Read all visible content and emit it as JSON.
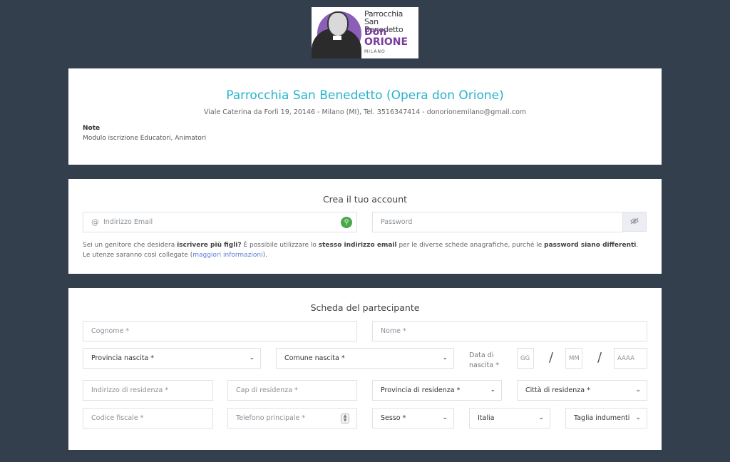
{
  "logo": {
    "line1": "Parrocchia",
    "line2": "San Benedetto",
    "line3": "Don",
    "line4": "ORIONE",
    "line5": "MILANO"
  },
  "header": {
    "title": "Parrocchia San Benedetto (Opera don Orione)",
    "address": "Viale Caterina da Forlì 19, 20146 - Milano (MI), Tel. 3516347414 - donorionemilano@gmail.com",
    "note_label": "Note",
    "note_text": "Modulo iscrizione Educatori, Animatori"
  },
  "account": {
    "title": "Crea il tuo account",
    "email_placeholder": "Indirizzo Email",
    "password_placeholder": "Password",
    "info": {
      "p1": "Sei un genitore che desidera ",
      "b1": "iscrivere più figli?",
      "p2": " È possibile utilizzare lo ",
      "b2": "stesso indirizzo email",
      "p3": " per le diverse schede anagrafiche, purché le ",
      "b3": "password siano differenti",
      "p4": ". Le utenze saranno così collegate (",
      "link": "maggiori informazioni",
      "p5": ")."
    }
  },
  "participant": {
    "title": "Scheda del partecipante",
    "cognome": "Cognome *",
    "nome": "Nome *",
    "provincia_nascita": "Provincia nascita *",
    "comune_nascita": "Comune nascita *",
    "data_nascita_label_1": "Data di",
    "data_nascita_label_2": "nascita *",
    "gg": "GG",
    "mm": "MM",
    "aaaa": "AAAA",
    "slash": "/",
    "indirizzo_residenza": "Indirizzo di residenza *",
    "cap_residenza": "Cap di residenza *",
    "provincia_residenza": "Provincia di residenza *",
    "citta_residenza": "Città di residenza *",
    "codice_fiscale": "Codice fiscale *",
    "telefono": "Telefono principale *",
    "sesso": "Sesso *",
    "nazione": "Italia",
    "taglia": "Taglia indumenti"
  },
  "colors": {
    "background": "#343f4d",
    "accent": "#27b3cc",
    "link": "#5a7fd6"
  }
}
